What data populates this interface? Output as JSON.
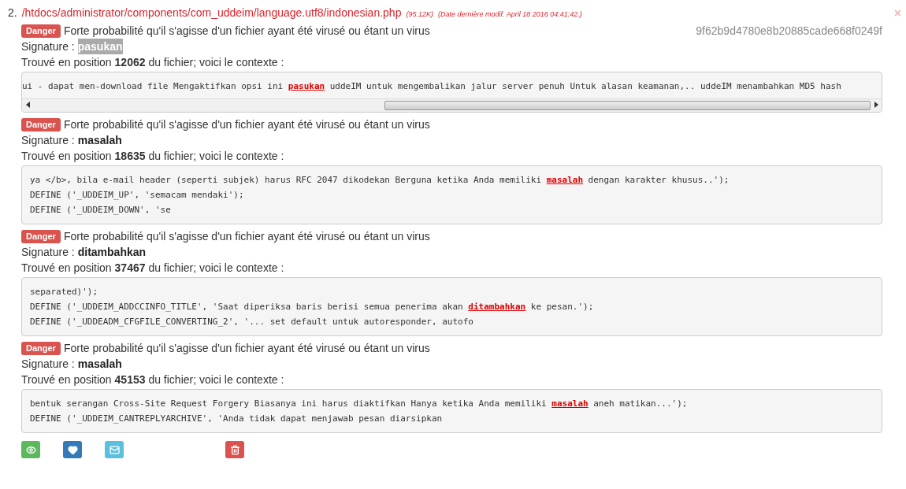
{
  "file": {
    "number": "2.",
    "path": "/htdocs/administrator/components/com_uddeim/language.utf8/indonesian.php",
    "size": "(95.12K)",
    "date": "(Date dernière modif. April 18 2016 04:41:42.)",
    "close": "×"
  },
  "findings": [
    {
      "badge": "Danger",
      "message": "Forte probabilité qu'il s'agisse d'un fichier ayant été virusé ou étant un virus",
      "hash": "9f62b9d4780e8b20885cade668f0249f",
      "signature_label": "Signature :",
      "signature": "pasukan",
      "signature_highlighted": true,
      "position_text": "Trouvé en position **12062** du fichier; voici le contexte :",
      "scrollable": true,
      "lines": [
        [
          {
            "text": "ui - dapat men-download file Mengaktifkan opsi ini ",
            "match": false
          },
          {
            "text": "pasukan",
            "match": true
          },
          {
            "text": " uddeIM untuk mengembalikan jalur server penuh Untuk alasan keamanan,.. uddeIM menambahkan MD5 hash",
            "match": false
          }
        ]
      ]
    },
    {
      "badge": "Danger",
      "message": "Forte probabilité qu'il s'agisse d'un fichier ayant été virusé ou étant un virus",
      "signature_label": "Signature :",
      "signature": "masalah",
      "signature_highlighted": false,
      "position_text": "Trouvé en position **18635** du fichier; voici le contexte :",
      "scrollable": false,
      "lines": [
        [
          {
            "text": "ya </b>, bila e-mail header (seperti subjek) harus RFC 2047 dikodekan Berguna ketika Anda memiliki ",
            "match": false
          },
          {
            "text": "masalah",
            "match": true
          },
          {
            "text": " dengan karakter khusus..');",
            "match": false
          }
        ],
        [
          {
            "text": "DEFINE ('_UDDEIM_UP', 'semacam mendaki');",
            "match": false
          }
        ],
        [
          {
            "text": "DEFINE ('_UDDEIM_DOWN', 'se",
            "match": false
          }
        ]
      ]
    },
    {
      "badge": "Danger",
      "message": "Forte probabilité qu'il s'agisse d'un fichier ayant été virusé ou étant un virus",
      "signature_label": "Signature :",
      "signature": "ditambahkan",
      "signature_highlighted": false,
      "position_text": "Trouvé en position **37467** du fichier; voici le contexte :",
      "scrollable": false,
      "lines": [
        [
          {
            "text": "separated)');",
            "match": false
          }
        ],
        [
          {
            "text": "DEFINE ('_UDDEIM_ADDCCINFO_TITLE', 'Saat diperiksa baris berisi semua penerima akan ",
            "match": false
          },
          {
            "text": "ditambahkan",
            "match": true
          },
          {
            "text": " ke pesan.');",
            "match": false
          }
        ],
        [
          {
            "text": "DEFINE ('_UDDEADM_CFGFILE_CONVERTING_2', '... set default untuk autoresponder, autofo",
            "match": false
          }
        ]
      ]
    },
    {
      "badge": "Danger",
      "message": "Forte probabilité qu'il s'agisse d'un fichier ayant été virusé ou étant un virus",
      "signature_label": "Signature :",
      "signature": "masalah",
      "signature_highlighted": false,
      "position_text": "Trouvé en position **45153** du fichier; voici le contexte :",
      "scrollable": false,
      "lines": [
        [
          {
            "text": "bentuk serangan Cross-Site Request Forgery Biasanya ini harus diaktifkan Hanya ketika Anda memiliki ",
            "match": false
          },
          {
            "text": "masalah",
            "match": true
          },
          {
            "text": " aneh matikan...');",
            "match": false
          }
        ],
        [
          {
            "text": "DEFINE ('_UDDEIM_CANTREPLYARCHIVE', 'Anda tidak dapat menjawab pesan diarsipkan",
            "match": false
          }
        ]
      ]
    }
  ],
  "actions": [
    {
      "kind": "view",
      "color": "#5cb85c"
    },
    {
      "kind": "favorite",
      "color": "#337ab7"
    },
    {
      "kind": "mail",
      "color": "#5bc0de"
    },
    {
      "kind": "delete",
      "color": "#d9534f"
    }
  ]
}
